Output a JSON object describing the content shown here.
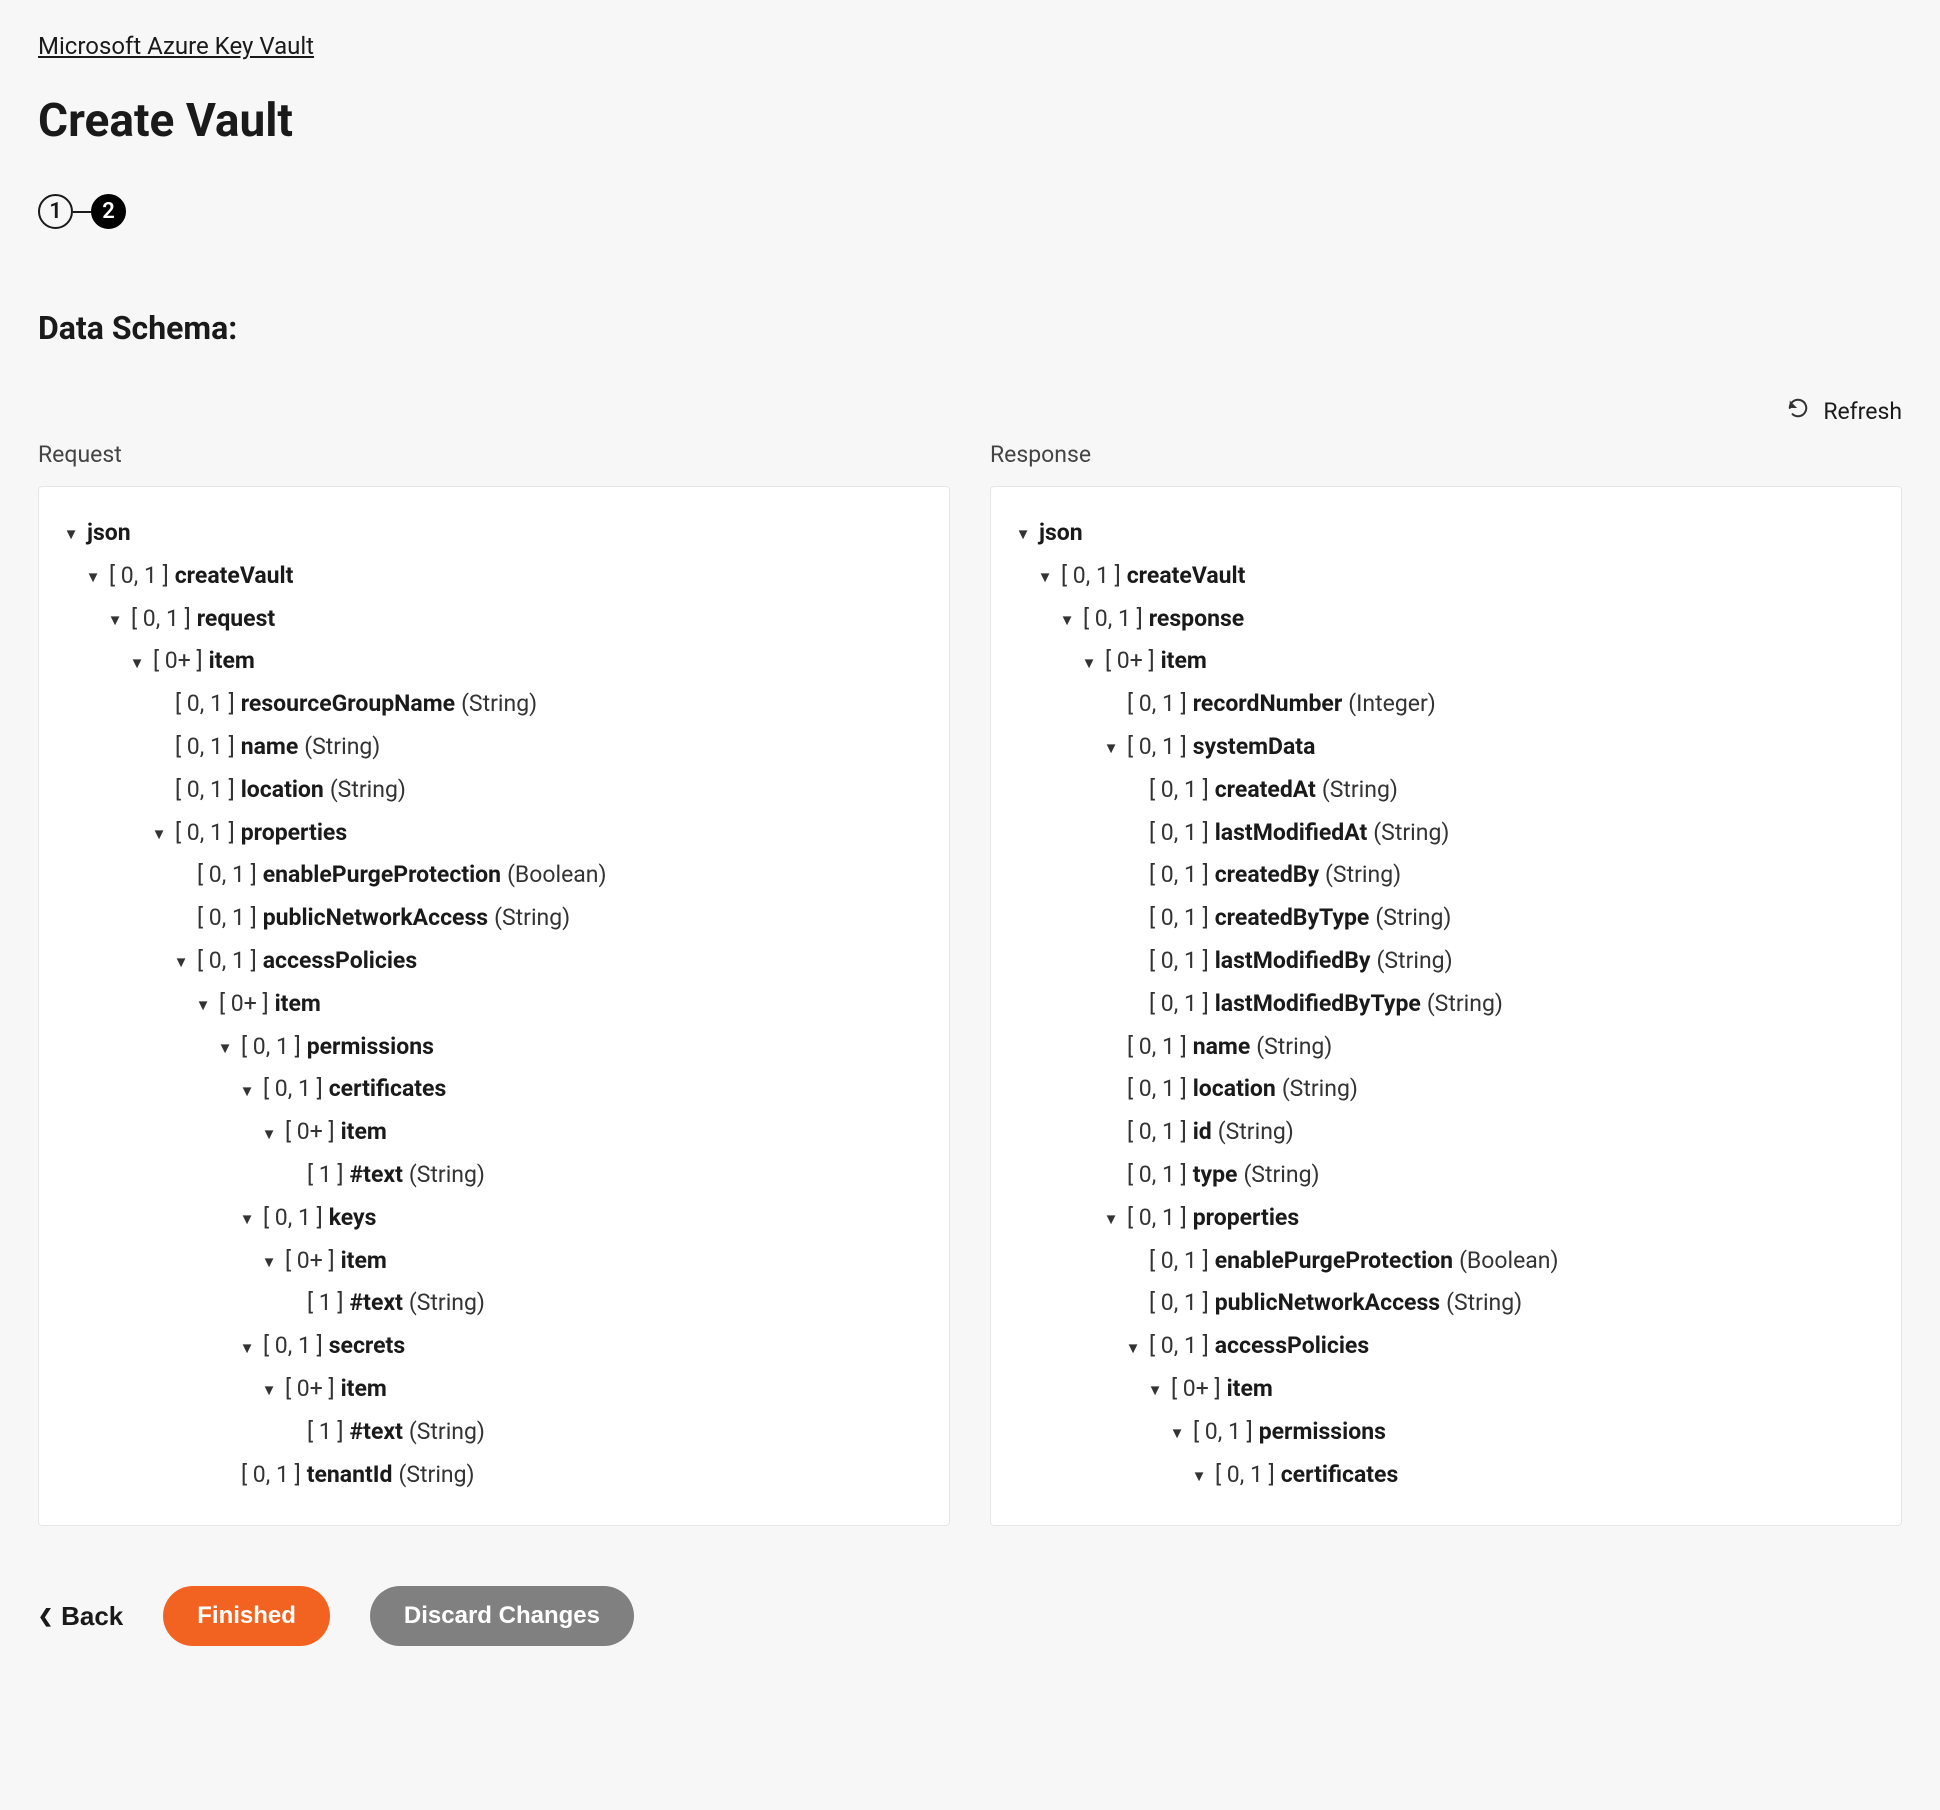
{
  "breadcrumb": "Microsoft Azure Key Vault",
  "page_title": "Create Vault",
  "stepper": {
    "step1": "1",
    "step2": "2"
  },
  "section_title": "Data Schema:",
  "refresh_label": "Refresh",
  "columns": {
    "request_label": "Request",
    "response_label": "Response"
  },
  "buttons": {
    "back": "Back",
    "finished": "Finished",
    "discard": "Discard Changes"
  },
  "request_tree": [
    {
      "d": 0,
      "chev": true,
      "name": "json"
    },
    {
      "d": 1,
      "chev": true,
      "card": "[ 0, 1 ]",
      "name": "createVault"
    },
    {
      "d": 2,
      "chev": true,
      "card": "[ 0, 1 ]",
      "name": "request"
    },
    {
      "d": 3,
      "chev": true,
      "card": "[ 0+ ]",
      "name": "item"
    },
    {
      "d": 4,
      "chev": false,
      "card": "[ 0, 1 ]",
      "name": "resourceGroupName",
      "type": "(String)"
    },
    {
      "d": 4,
      "chev": false,
      "card": "[ 0, 1 ]",
      "name": "name",
      "type": "(String)"
    },
    {
      "d": 4,
      "chev": false,
      "card": "[ 0, 1 ]",
      "name": "location",
      "type": "(String)"
    },
    {
      "d": 4,
      "chev": true,
      "card": "[ 0, 1 ]",
      "name": "properties"
    },
    {
      "d": 5,
      "chev": false,
      "card": "[ 0, 1 ]",
      "name": "enablePurgeProtection",
      "type": "(Boolean)"
    },
    {
      "d": 5,
      "chev": false,
      "card": "[ 0, 1 ]",
      "name": "publicNetworkAccess",
      "type": "(String)"
    },
    {
      "d": 5,
      "chev": true,
      "card": "[ 0, 1 ]",
      "name": "accessPolicies"
    },
    {
      "d": 6,
      "chev": true,
      "card": "[ 0+ ]",
      "name": "item"
    },
    {
      "d": 7,
      "chev": true,
      "card": "[ 0, 1 ]",
      "name": "permissions"
    },
    {
      "d": 8,
      "chev": true,
      "card": "[ 0, 1 ]",
      "name": "certificates"
    },
    {
      "d": 9,
      "chev": true,
      "card": "[ 0+ ]",
      "name": "item"
    },
    {
      "d": 10,
      "chev": false,
      "card": "[ 1 ]",
      "name": "#text",
      "type": "(String)"
    },
    {
      "d": 8,
      "chev": true,
      "card": "[ 0, 1 ]",
      "name": "keys"
    },
    {
      "d": 9,
      "chev": true,
      "card": "[ 0+ ]",
      "name": "item"
    },
    {
      "d": 10,
      "chev": false,
      "card": "[ 1 ]",
      "name": "#text",
      "type": "(String)"
    },
    {
      "d": 8,
      "chev": true,
      "card": "[ 0, 1 ]",
      "name": "secrets"
    },
    {
      "d": 9,
      "chev": true,
      "card": "[ 0+ ]",
      "name": "item"
    },
    {
      "d": 10,
      "chev": false,
      "card": "[ 1 ]",
      "name": "#text",
      "type": "(String)"
    },
    {
      "d": 7,
      "chev": false,
      "card": "[ 0, 1 ]",
      "name": "tenantId",
      "type": "(String)"
    }
  ],
  "response_tree": [
    {
      "d": 0,
      "chev": true,
      "name": "json"
    },
    {
      "d": 1,
      "chev": true,
      "card": "[ 0, 1 ]",
      "name": "createVault"
    },
    {
      "d": 2,
      "chev": true,
      "card": "[ 0, 1 ]",
      "name": "response"
    },
    {
      "d": 3,
      "chev": true,
      "card": "[ 0+ ]",
      "name": "item"
    },
    {
      "d": 4,
      "chev": false,
      "card": "[ 0, 1 ]",
      "name": "recordNumber",
      "type": "(Integer)"
    },
    {
      "d": 4,
      "chev": true,
      "card": "[ 0, 1 ]",
      "name": "systemData"
    },
    {
      "d": 5,
      "chev": false,
      "card": "[ 0, 1 ]",
      "name": "createdAt",
      "type": "(String)"
    },
    {
      "d": 5,
      "chev": false,
      "card": "[ 0, 1 ]",
      "name": "lastModifiedAt",
      "type": "(String)"
    },
    {
      "d": 5,
      "chev": false,
      "card": "[ 0, 1 ]",
      "name": "createdBy",
      "type": "(String)"
    },
    {
      "d": 5,
      "chev": false,
      "card": "[ 0, 1 ]",
      "name": "createdByType",
      "type": "(String)"
    },
    {
      "d": 5,
      "chev": false,
      "card": "[ 0, 1 ]",
      "name": "lastModifiedBy",
      "type": "(String)"
    },
    {
      "d": 5,
      "chev": false,
      "card": "[ 0, 1 ]",
      "name": "lastModifiedByType",
      "type": "(String)"
    },
    {
      "d": 4,
      "chev": false,
      "card": "[ 0, 1 ]",
      "name": "name",
      "type": "(String)"
    },
    {
      "d": 4,
      "chev": false,
      "card": "[ 0, 1 ]",
      "name": "location",
      "type": "(String)"
    },
    {
      "d": 4,
      "chev": false,
      "card": "[ 0, 1 ]",
      "name": "id",
      "type": "(String)"
    },
    {
      "d": 4,
      "chev": false,
      "card": "[ 0, 1 ]",
      "name": "type",
      "type": "(String)"
    },
    {
      "d": 4,
      "chev": true,
      "card": "[ 0, 1 ]",
      "name": "properties"
    },
    {
      "d": 5,
      "chev": false,
      "card": "[ 0, 1 ]",
      "name": "enablePurgeProtection",
      "type": "(Boolean)"
    },
    {
      "d": 5,
      "chev": false,
      "card": "[ 0, 1 ]",
      "name": "publicNetworkAccess",
      "type": "(String)"
    },
    {
      "d": 5,
      "chev": true,
      "card": "[ 0, 1 ]",
      "name": "accessPolicies"
    },
    {
      "d": 6,
      "chev": true,
      "card": "[ 0+ ]",
      "name": "item"
    },
    {
      "d": 7,
      "chev": true,
      "card": "[ 0, 1 ]",
      "name": "permissions"
    },
    {
      "d": 8,
      "chev": true,
      "card": "[ 0, 1 ]",
      "name": "certificates"
    }
  ]
}
